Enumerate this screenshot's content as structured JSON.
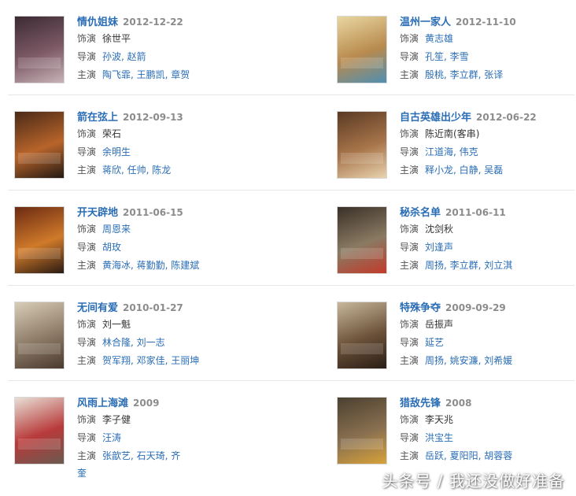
{
  "labels": {
    "role": "饰演",
    "director": "导演",
    "cast": "主演"
  },
  "items": [
    {
      "title": "情仇姐妹",
      "date": "2012-12-22",
      "role": "徐世平",
      "role_link": false,
      "director": "孙波, 赵箭",
      "cast": "陶飞霏, 王鹏凯, 章贺",
      "poster_colors": [
        "#3b2a33",
        "#7d5a66",
        "#c8b3b8"
      ]
    },
    {
      "title": "温州一家人",
      "date": "2012-11-10",
      "role": "黄志雄",
      "role_link": true,
      "director": "孔笙, 李雪",
      "cast": "殷桃, 李立群, 张译",
      "poster_colors": [
        "#e9d7a0",
        "#b88a4e",
        "#4f8fb3"
      ]
    },
    {
      "title": "箭在弦上",
      "date": "2012-09-13",
      "role": "荣石",
      "role_link": false,
      "director": "余明生",
      "cast": "蒋欣, 任帅, 陈龙",
      "poster_colors": [
        "#4a2a18",
        "#b8642a",
        "#241a14"
      ]
    },
    {
      "title": "自古英雄出少年",
      "date": "2012-06-22",
      "role": "陈近南(客串)",
      "role_link": false,
      "director": "江道海, 伟克",
      "cast": "释小龙, 白静, 吴磊",
      "poster_colors": [
        "#5a3a24",
        "#a8754a",
        "#e8d3b0"
      ]
    },
    {
      "title": "开天辟地",
      "date": "2011-06-15",
      "role": "周恩来",
      "role_link": true,
      "director": "胡玫",
      "cast": "黄海冰, 蒋勤勤, 陈建斌",
      "poster_colors": [
        "#6b2a12",
        "#d07a2a",
        "#2a1a12"
      ]
    },
    {
      "title": "秘杀名单",
      "date": "2011-06-11",
      "role": "沈剑秋",
      "role_link": false,
      "director": "刘逢声",
      "cast": "周扬, 李立群, 刘立淇",
      "poster_colors": [
        "#3a3028",
        "#8a7a62",
        "#c23a2a"
      ]
    },
    {
      "title": "无间有爱",
      "date": "2010-01-27",
      "role": "刘一魁",
      "role_link": false,
      "director": "林合隆, 刘一志",
      "cast": "贺军翔, 邓家佳, 王丽坤",
      "poster_colors": [
        "#d9cdb8",
        "#8c7a66",
        "#4a3a30"
      ]
    },
    {
      "title": "特殊争夺",
      "date": "2009-09-29",
      "role": "岳振声",
      "role_link": false,
      "director": "延艺",
      "cast": "周扬, 姚安濂, 刘希媛",
      "poster_colors": [
        "#c8b89a",
        "#6a5038",
        "#2a1e16"
      ]
    },
    {
      "title": "风雨上海滩",
      "date": "2009",
      "role": "李子健",
      "role_link": false,
      "director": "汪涛",
      "cast": "张歆艺, 石天琦, 齐奎",
      "poster_colors": [
        "#e8e0d6",
        "#b83a3a",
        "#6a5a50"
      ]
    },
    {
      "title": "猎敌先锋",
      "date": "2008",
      "role": "李天兆",
      "role_link": false,
      "director": "洪宝生",
      "cast": "岳跃, 夏阳阳, 胡蓉蓉",
      "poster_colors": [
        "#4a4030",
        "#8a7050",
        "#d8a23a"
      ]
    }
  ],
  "watermark": "头条号 / 我还没做好准备"
}
